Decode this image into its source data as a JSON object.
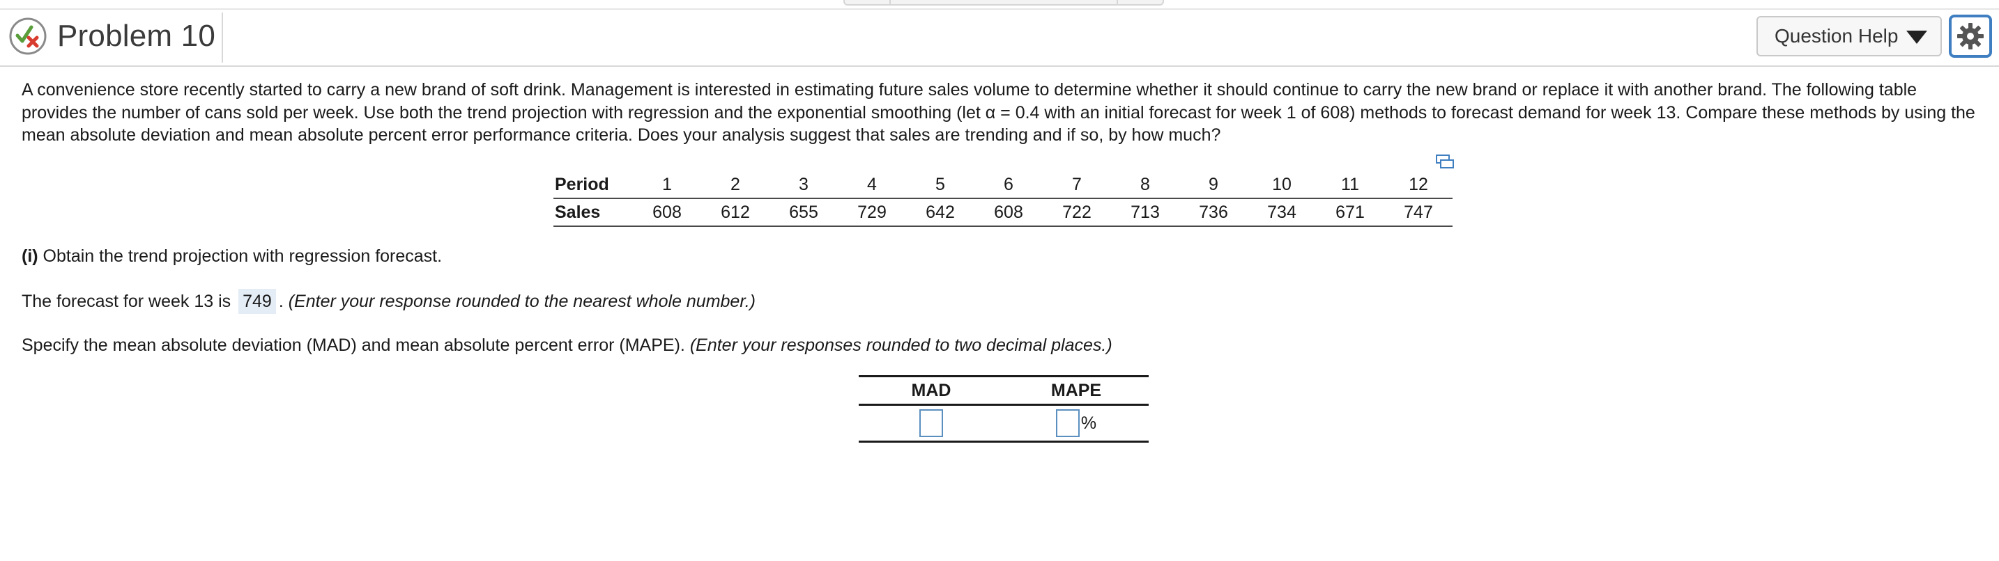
{
  "header": {
    "title": "Problem 10",
    "help_label": "Question Help"
  },
  "icons": {
    "status": "partial-correct-icon",
    "help_caret": "caret-down-icon",
    "settings": "gear-icon",
    "expand": "expand-table-icon"
  },
  "colors": {
    "check": "#5a9e3c",
    "cross": "#d83c2e",
    "accent": "#3f7fc1",
    "answer_highlight": "#e4ecf5"
  },
  "question": {
    "text_before_alpha": "A convenience store recently started to carry a new brand of soft drink. Management is interested in estimating future sales volume to determine whether it should continue to carry the new brand or replace it with another brand. The following table provides the number of cans sold per week. Use both the trend projection with regression and the exponential smoothing (let ",
    "alpha": "α = 0.4",
    "text_after_alpha": " with an initial forecast for week 1 of 608) methods to forecast demand for week 13. Compare these methods by using the mean absolute deviation and mean absolute percent error performance criteria. Does your analysis suggest that sales are trending and if so, by how much?"
  },
  "table": {
    "row1_label": "Period",
    "row2_label": "Sales",
    "periods": [
      "1",
      "2",
      "3",
      "4",
      "5",
      "6",
      "7",
      "8",
      "9",
      "10",
      "11",
      "12"
    ],
    "sales": [
      "608",
      "612",
      "655",
      "729",
      "642",
      "608",
      "722",
      "713",
      "736",
      "734",
      "671",
      "747"
    ]
  },
  "part_i": {
    "label_prefix": "(i)",
    "label_text": " Obtain the trend projection with regression forecast.",
    "forecast_prefix": "The forecast for week 13 is ",
    "forecast_value": "749",
    "forecast_suffix": ". ",
    "forecast_hint": "(Enter your response rounded to the nearest whole number.)",
    "mad_prompt": "Specify the mean absolute deviation (MAD) and mean absolute percent error (MAPE). ",
    "mad_hint": "(Enter your responses rounded to two decimal places.)"
  },
  "mad_table": {
    "col1": "MAD",
    "col2": "MAPE",
    "mad_value": "",
    "mape_value": "",
    "mape_unit": "%"
  }
}
